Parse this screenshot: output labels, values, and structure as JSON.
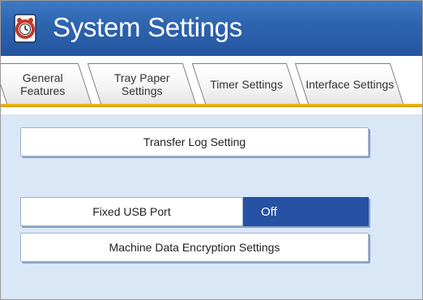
{
  "header": {
    "title": "System Settings",
    "icon": "settings-clock-icon"
  },
  "tabs": [
    {
      "line1": "General",
      "line2": "Features"
    },
    {
      "line1": "Tray Paper",
      "line2": "Settings"
    },
    {
      "line1": "Timer",
      "line2": "Settings"
    },
    {
      "line1": "Interface",
      "line2": "Settings"
    }
  ],
  "main": {
    "transfer_log_label": "Transfer Log Setting",
    "fixed_usb_label": "Fixed USB Port",
    "fixed_usb_value": "Off",
    "encryption_label": "Machine Data Encryption Settings"
  },
  "colors": {
    "title_bar": "#2e63ad",
    "tab_accent": "#f0b400",
    "content_bg": "#d9e7f7",
    "selected_value": "#2652a3"
  }
}
